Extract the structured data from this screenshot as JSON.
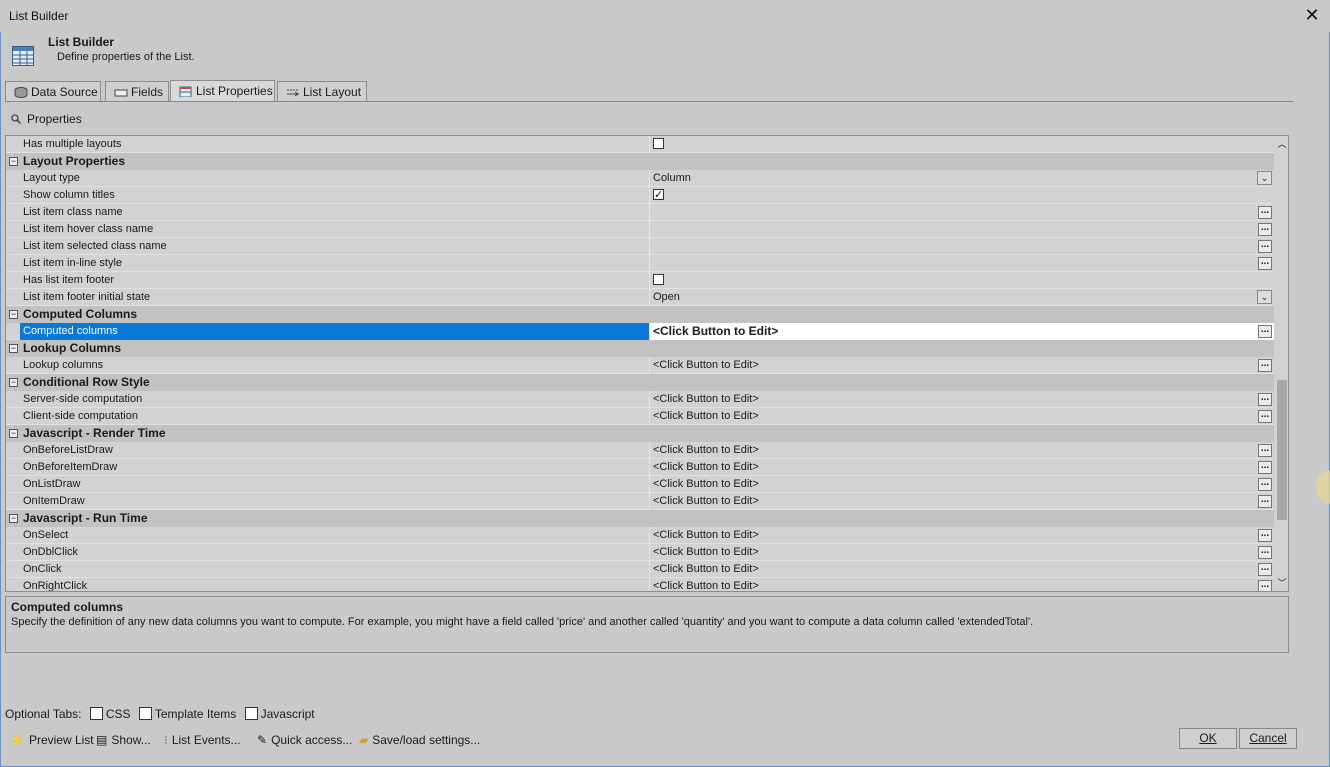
{
  "window": {
    "title": "List Builder"
  },
  "header": {
    "title": "List Builder",
    "subtitle": "Define properties of the List."
  },
  "tabs": [
    {
      "label": "Data Source",
      "icon": "database-icon"
    },
    {
      "label": "Fields",
      "icon": "field-icon"
    },
    {
      "label": "List Properties",
      "icon": "list-properties-icon",
      "active": true
    },
    {
      "label": "List Layout",
      "icon": "list-layout-icon"
    }
  ],
  "properties_label": "Properties",
  "grid": {
    "rows": [
      {
        "type": "prop",
        "name": "Has multiple layouts",
        "editor": "checkbox",
        "checked": false
      },
      {
        "type": "cat",
        "name": "Layout Properties"
      },
      {
        "type": "prop",
        "name": "Layout type",
        "value": "Column",
        "editor": "dropdown"
      },
      {
        "type": "prop",
        "name": "Show column titles",
        "editor": "checkbox",
        "checked": true
      },
      {
        "type": "prop",
        "name": "List item class name",
        "value": "",
        "editor": "ellipsis"
      },
      {
        "type": "prop",
        "name": "List item hover class name",
        "value": "",
        "editor": "ellipsis"
      },
      {
        "type": "prop",
        "name": "List item selected class name",
        "value": "",
        "editor": "ellipsis"
      },
      {
        "type": "prop",
        "name": "List item in-line style",
        "value": "",
        "editor": "ellipsis"
      },
      {
        "type": "prop",
        "name": "Has list item footer",
        "editor": "checkbox",
        "checked": false
      },
      {
        "type": "prop",
        "name": "List item footer initial state",
        "value": "Open",
        "editor": "dropdown"
      },
      {
        "type": "cat",
        "name": "Computed Columns"
      },
      {
        "type": "prop",
        "name": "Computed columns",
        "value": "<Click Button to Edit>",
        "editor": "ellipsis",
        "selected": true
      },
      {
        "type": "cat",
        "name": "Lookup Columns"
      },
      {
        "type": "prop",
        "name": "Lookup columns",
        "value": "<Click Button to Edit>",
        "editor": "ellipsis"
      },
      {
        "type": "cat",
        "name": "Conditional Row Style"
      },
      {
        "type": "prop",
        "name": "Server-side computation",
        "value": "<Click Button to Edit>",
        "editor": "ellipsis"
      },
      {
        "type": "prop",
        "name": "Client-side computation",
        "value": "<Click Button to Edit>",
        "editor": "ellipsis"
      },
      {
        "type": "cat",
        "name": "Javascript - Render Time"
      },
      {
        "type": "prop",
        "name": "OnBeforeListDraw",
        "value": "<Click Button to Edit>",
        "editor": "ellipsis"
      },
      {
        "type": "prop",
        "name": "OnBeforeItemDraw",
        "value": "<Click Button to Edit>",
        "editor": "ellipsis"
      },
      {
        "type": "prop",
        "name": "OnListDraw",
        "value": "<Click Button to Edit>",
        "editor": "ellipsis"
      },
      {
        "type": "prop",
        "name": "OnItemDraw",
        "value": "<Click Button to Edit>",
        "editor": "ellipsis"
      },
      {
        "type": "cat",
        "name": "Javascript - Run Time"
      },
      {
        "type": "prop",
        "name": "OnSelect",
        "value": "<Click Button to Edit>",
        "editor": "ellipsis"
      },
      {
        "type": "prop",
        "name": "OnDblClick",
        "value": "<Click Button to Edit>",
        "editor": "ellipsis"
      },
      {
        "type": "prop",
        "name": "OnClick",
        "value": "<Click Button to Edit>",
        "editor": "ellipsis"
      },
      {
        "type": "prop",
        "name": "OnRightClick",
        "value": "<Click Button to Edit>",
        "editor": "ellipsis"
      }
    ]
  },
  "description": {
    "title": "Computed columns",
    "text": "Specify the definition of any new data columns you want to compute. For example, you might have a field called 'price' and another called 'quantity' and you want to compute a data column called 'extendedTotal'."
  },
  "optional_tabs": {
    "label": "Optional Tabs:",
    "items": [
      {
        "label": "CSS",
        "checked": false
      },
      {
        "label": "Template Items",
        "checked": false
      },
      {
        "label": "Javascript",
        "checked": false
      }
    ]
  },
  "bottom_actions": [
    {
      "label": "Preview List",
      "icon": "lightning-icon"
    },
    {
      "label": "Show...",
      "icon": "show-icon"
    },
    {
      "label": "List Events...",
      "icon": "events-icon"
    },
    {
      "label": "Quick access...",
      "icon": "quick-access-icon"
    },
    {
      "label": "Save/load settings...",
      "icon": "folder-icon"
    }
  ],
  "buttons": {
    "ok": "OK",
    "cancel": "Cancel"
  }
}
